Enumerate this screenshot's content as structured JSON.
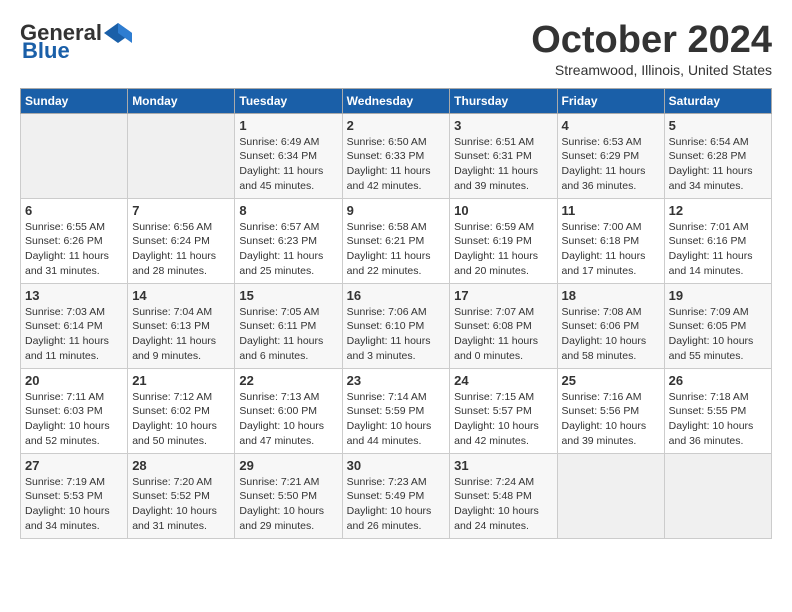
{
  "header": {
    "logo_general": "General",
    "logo_blue": "Blue",
    "month": "October 2024",
    "location": "Streamwood, Illinois, United States"
  },
  "weekdays": [
    "Sunday",
    "Monday",
    "Tuesday",
    "Wednesday",
    "Thursday",
    "Friday",
    "Saturday"
  ],
  "weeks": [
    [
      {
        "day": null
      },
      {
        "day": null
      },
      {
        "day": "1",
        "sunrise": "Sunrise: 6:49 AM",
        "sunset": "Sunset: 6:34 PM",
        "daylight": "Daylight: 11 hours and 45 minutes."
      },
      {
        "day": "2",
        "sunrise": "Sunrise: 6:50 AM",
        "sunset": "Sunset: 6:33 PM",
        "daylight": "Daylight: 11 hours and 42 minutes."
      },
      {
        "day": "3",
        "sunrise": "Sunrise: 6:51 AM",
        "sunset": "Sunset: 6:31 PM",
        "daylight": "Daylight: 11 hours and 39 minutes."
      },
      {
        "day": "4",
        "sunrise": "Sunrise: 6:53 AM",
        "sunset": "Sunset: 6:29 PM",
        "daylight": "Daylight: 11 hours and 36 minutes."
      },
      {
        "day": "5",
        "sunrise": "Sunrise: 6:54 AM",
        "sunset": "Sunset: 6:28 PM",
        "daylight": "Daylight: 11 hours and 34 minutes."
      }
    ],
    [
      {
        "day": "6",
        "sunrise": "Sunrise: 6:55 AM",
        "sunset": "Sunset: 6:26 PM",
        "daylight": "Daylight: 11 hours and 31 minutes."
      },
      {
        "day": "7",
        "sunrise": "Sunrise: 6:56 AM",
        "sunset": "Sunset: 6:24 PM",
        "daylight": "Daylight: 11 hours and 28 minutes."
      },
      {
        "day": "8",
        "sunrise": "Sunrise: 6:57 AM",
        "sunset": "Sunset: 6:23 PM",
        "daylight": "Daylight: 11 hours and 25 minutes."
      },
      {
        "day": "9",
        "sunrise": "Sunrise: 6:58 AM",
        "sunset": "Sunset: 6:21 PM",
        "daylight": "Daylight: 11 hours and 22 minutes."
      },
      {
        "day": "10",
        "sunrise": "Sunrise: 6:59 AM",
        "sunset": "Sunset: 6:19 PM",
        "daylight": "Daylight: 11 hours and 20 minutes."
      },
      {
        "day": "11",
        "sunrise": "Sunrise: 7:00 AM",
        "sunset": "Sunset: 6:18 PM",
        "daylight": "Daylight: 11 hours and 17 minutes."
      },
      {
        "day": "12",
        "sunrise": "Sunrise: 7:01 AM",
        "sunset": "Sunset: 6:16 PM",
        "daylight": "Daylight: 11 hours and 14 minutes."
      }
    ],
    [
      {
        "day": "13",
        "sunrise": "Sunrise: 7:03 AM",
        "sunset": "Sunset: 6:14 PM",
        "daylight": "Daylight: 11 hours and 11 minutes."
      },
      {
        "day": "14",
        "sunrise": "Sunrise: 7:04 AM",
        "sunset": "Sunset: 6:13 PM",
        "daylight": "Daylight: 11 hours and 9 minutes."
      },
      {
        "day": "15",
        "sunrise": "Sunrise: 7:05 AM",
        "sunset": "Sunset: 6:11 PM",
        "daylight": "Daylight: 11 hours and 6 minutes."
      },
      {
        "day": "16",
        "sunrise": "Sunrise: 7:06 AM",
        "sunset": "Sunset: 6:10 PM",
        "daylight": "Daylight: 11 hours and 3 minutes."
      },
      {
        "day": "17",
        "sunrise": "Sunrise: 7:07 AM",
        "sunset": "Sunset: 6:08 PM",
        "daylight": "Daylight: 11 hours and 0 minutes."
      },
      {
        "day": "18",
        "sunrise": "Sunrise: 7:08 AM",
        "sunset": "Sunset: 6:06 PM",
        "daylight": "Daylight: 10 hours and 58 minutes."
      },
      {
        "day": "19",
        "sunrise": "Sunrise: 7:09 AM",
        "sunset": "Sunset: 6:05 PM",
        "daylight": "Daylight: 10 hours and 55 minutes."
      }
    ],
    [
      {
        "day": "20",
        "sunrise": "Sunrise: 7:11 AM",
        "sunset": "Sunset: 6:03 PM",
        "daylight": "Daylight: 10 hours and 52 minutes."
      },
      {
        "day": "21",
        "sunrise": "Sunrise: 7:12 AM",
        "sunset": "Sunset: 6:02 PM",
        "daylight": "Daylight: 10 hours and 50 minutes."
      },
      {
        "day": "22",
        "sunrise": "Sunrise: 7:13 AM",
        "sunset": "Sunset: 6:00 PM",
        "daylight": "Daylight: 10 hours and 47 minutes."
      },
      {
        "day": "23",
        "sunrise": "Sunrise: 7:14 AM",
        "sunset": "Sunset: 5:59 PM",
        "daylight": "Daylight: 10 hours and 44 minutes."
      },
      {
        "day": "24",
        "sunrise": "Sunrise: 7:15 AM",
        "sunset": "Sunset: 5:57 PM",
        "daylight": "Daylight: 10 hours and 42 minutes."
      },
      {
        "day": "25",
        "sunrise": "Sunrise: 7:16 AM",
        "sunset": "Sunset: 5:56 PM",
        "daylight": "Daylight: 10 hours and 39 minutes."
      },
      {
        "day": "26",
        "sunrise": "Sunrise: 7:18 AM",
        "sunset": "Sunset: 5:55 PM",
        "daylight": "Daylight: 10 hours and 36 minutes."
      }
    ],
    [
      {
        "day": "27",
        "sunrise": "Sunrise: 7:19 AM",
        "sunset": "Sunset: 5:53 PM",
        "daylight": "Daylight: 10 hours and 34 minutes."
      },
      {
        "day": "28",
        "sunrise": "Sunrise: 7:20 AM",
        "sunset": "Sunset: 5:52 PM",
        "daylight": "Daylight: 10 hours and 31 minutes."
      },
      {
        "day": "29",
        "sunrise": "Sunrise: 7:21 AM",
        "sunset": "Sunset: 5:50 PM",
        "daylight": "Daylight: 10 hours and 29 minutes."
      },
      {
        "day": "30",
        "sunrise": "Sunrise: 7:23 AM",
        "sunset": "Sunset: 5:49 PM",
        "daylight": "Daylight: 10 hours and 26 minutes."
      },
      {
        "day": "31",
        "sunrise": "Sunrise: 7:24 AM",
        "sunset": "Sunset: 5:48 PM",
        "daylight": "Daylight: 10 hours and 24 minutes."
      },
      {
        "day": null
      },
      {
        "day": null
      }
    ]
  ]
}
